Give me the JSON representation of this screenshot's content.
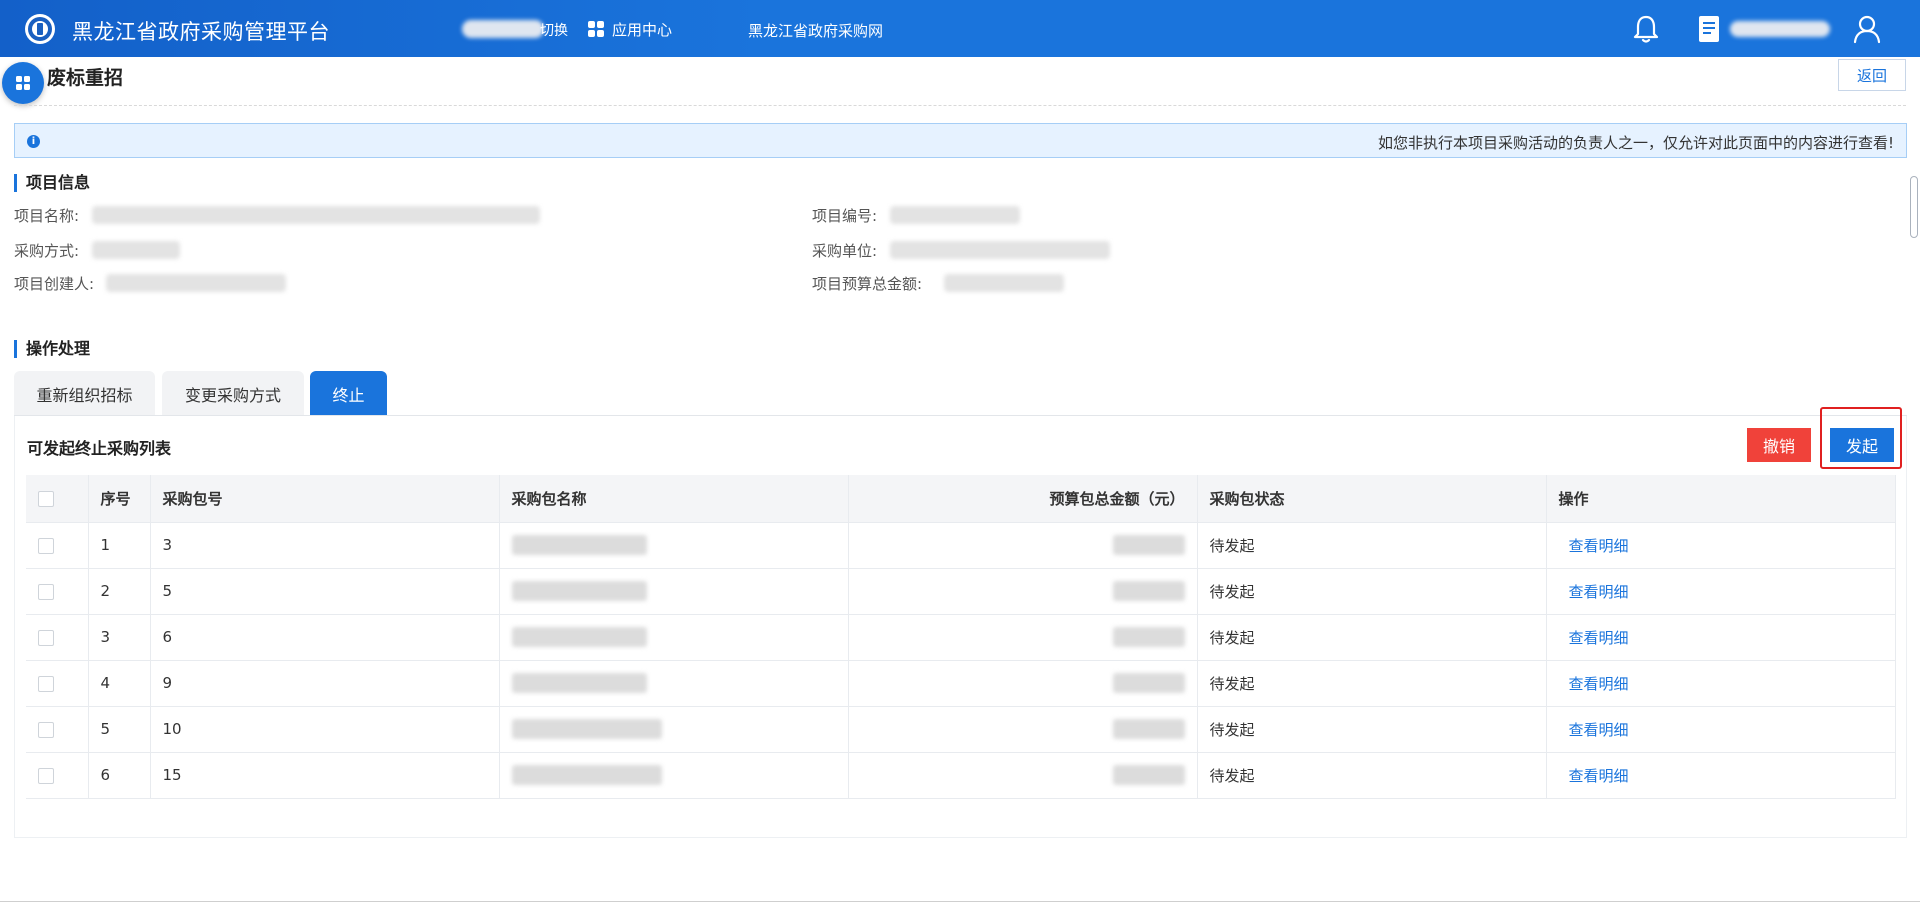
{
  "header": {
    "platform_title": "黑龙江省政府采购管理平台",
    "switch_label": "切换",
    "app_center_label": "应用中心",
    "gov_site_label": "黑龙江省政府采购网"
  },
  "page": {
    "title": "废标重招",
    "back_label": "返回"
  },
  "notice": {
    "text": "如您非执行本项目采购活动的负责人之一，仅允许对此页面中的内容进行查看!"
  },
  "project_info": {
    "section_title": "项目信息",
    "labels": {
      "name": "项目名称:",
      "method": "采购方式:",
      "creator": "项目创建人:",
      "code": "项目编号:",
      "unit": "采购单位:",
      "budget": "项目预算总金额:"
    }
  },
  "operations": {
    "section_title": "操作处理",
    "tabs": [
      {
        "label": "重新组织招标",
        "active": false
      },
      {
        "label": "变更采购方式",
        "active": false
      },
      {
        "label": "终止",
        "active": true
      }
    ]
  },
  "list": {
    "title": "可发起终止采购列表",
    "cancel_label": "撤销",
    "launch_label": "发起",
    "columns": [
      "序号",
      "采购包号",
      "采购包名称",
      "预算包总金额（元）",
      "采购包状态",
      "操作"
    ],
    "rows": [
      {
        "index": "1",
        "package_no": "3",
        "status": "待发起",
        "action": "查看明细"
      },
      {
        "index": "2",
        "package_no": "5",
        "status": "待发起",
        "action": "查看明细"
      },
      {
        "index": "3",
        "package_no": "6",
        "status": "待发起",
        "action": "查看明细"
      },
      {
        "index": "4",
        "package_no": "9",
        "status": "待发起",
        "action": "查看明细"
      },
      {
        "index": "5",
        "package_no": "10",
        "status": "待发起",
        "action": "查看明细"
      },
      {
        "index": "6",
        "package_no": "15",
        "status": "待发起",
        "action": "查看明细"
      }
    ]
  },
  "colors": {
    "primary": "#1a74dc",
    "danger": "#f0423a",
    "highlight": "#e02020",
    "notice_bg": "#e6f2ff"
  },
  "icons": {
    "logo": "emblem-icon",
    "app_center": "grid-icon",
    "bell": "bell-icon",
    "document": "document-icon",
    "user": "user-icon",
    "info": "info-icon"
  }
}
